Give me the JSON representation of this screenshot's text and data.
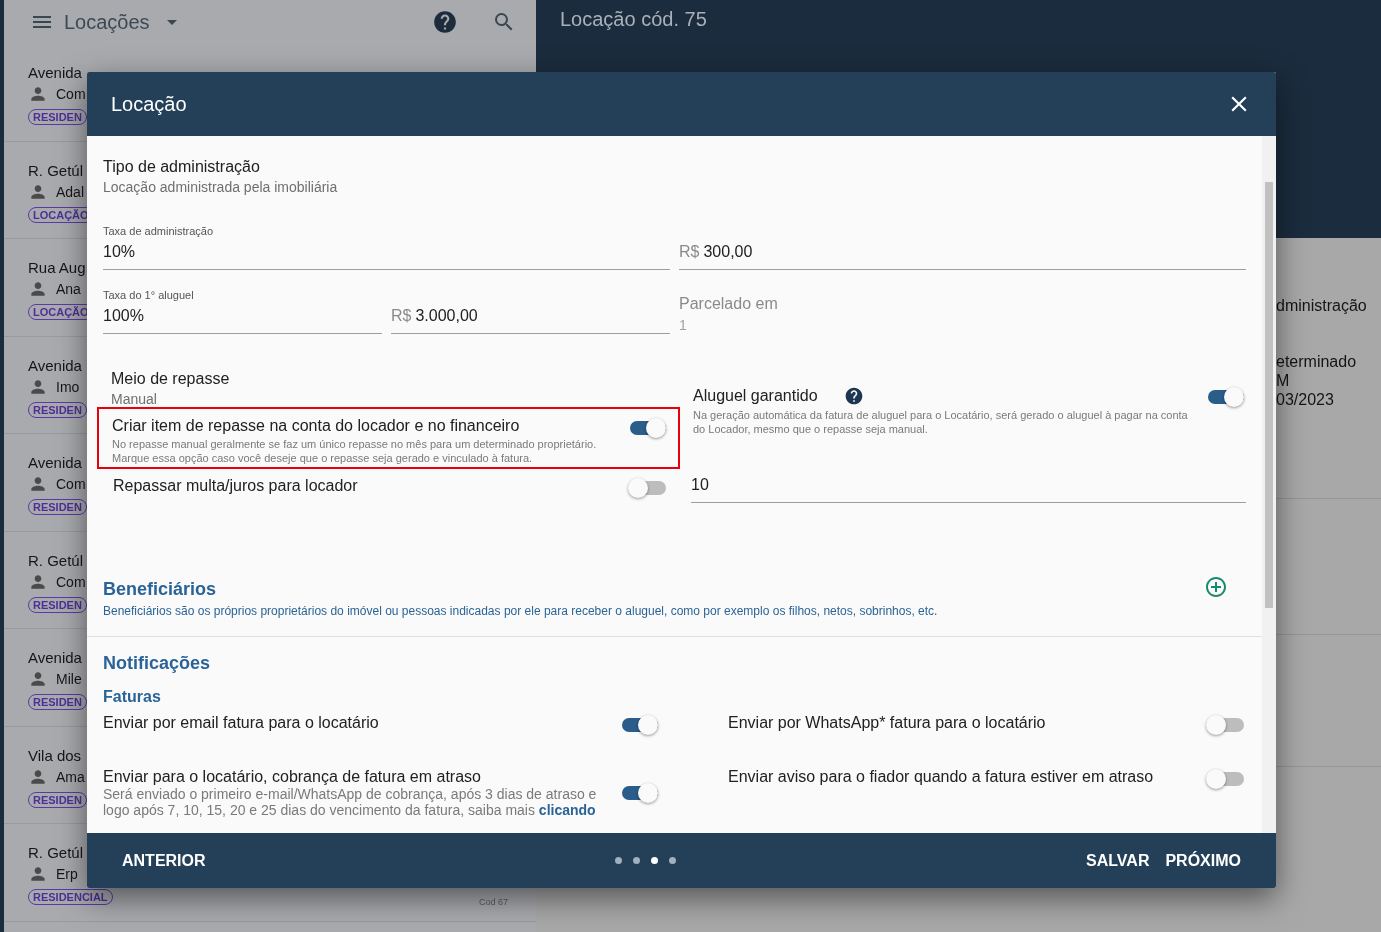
{
  "app_bar": {
    "title": "Locações"
  },
  "rentals": [
    {
      "address": "Avenida",
      "person": "Com",
      "tag": "RESIDEN"
    },
    {
      "address": "R. Getúl",
      "person": "Adal",
      "tag": "LOCAÇÃO"
    },
    {
      "address": "Rua Aug",
      "person": "Ana",
      "tag": "LOCAÇÃO"
    },
    {
      "address": "Avenida",
      "person": "Imo",
      "tag": "RESIDEN"
    },
    {
      "address": "Avenida",
      "person": "Com",
      "tag": "RESIDEN"
    },
    {
      "address": "R. Getúl",
      "person": "Com",
      "tag": "RESIDEN"
    },
    {
      "address": "Avenida",
      "person": "Mile",
      "tag": "RESIDEN"
    },
    {
      "address": "Vila dos",
      "person": "Ama",
      "tag": "RESIDEN"
    },
    {
      "address": "R. Getúl",
      "person": "Erp",
      "tag": "RESIDENCIAL",
      "code": "Cod 67"
    }
  ],
  "detail": {
    "title": "Locação cód. 75",
    "lines": [
      "dministração",
      "eterminado",
      "M",
      "03/2023"
    ]
  },
  "dialog": {
    "title": "Locação",
    "admin_type": {
      "label": "Tipo de administração",
      "value": "Locação administrada pela imobiliária"
    },
    "fields": [
      {
        "kind": "text",
        "label": "Taxa de administração",
        "value": "10%"
      },
      {
        "kind": "money",
        "prefix": "R$",
        "value": "300,00"
      },
      {
        "kind": "text",
        "label": "Taxa do 1° aluguel",
        "value": "100%"
      },
      {
        "kind": "money",
        "prefix": "R$",
        "value": "3.000,00"
      },
      {
        "kind": "disabled",
        "label": "Parcelado em",
        "value": "1"
      }
    ],
    "transfer_method": {
      "label": "Meio de repasse",
      "value": "Manual"
    },
    "transfer_options": [
      {
        "label": "Criar item de repasse na conta do locador e no financeiro",
        "description": "No repasse manual geralmente se faz um único repasse no mês para um determinado proprietário. Marque essa opção caso você deseje que o repasse seja gerado e vinculado à fatura.",
        "on": true,
        "highlighted": true
      },
      {
        "label": "Repassar multa/juros para locador",
        "on": false,
        "highlighted": false
      }
    ],
    "guaranteed_rent": {
      "label": "Aluguel garantido",
      "on": true,
      "description": "Na geração automática da fatura de aluguel para o Locatário, será gerado o aluguel à pagar na conta do Locador, mesmo que o repasse seja manual.",
      "value": "10"
    },
    "beneficiaries": {
      "title": "Beneficiários",
      "description": "Beneficiários são os próprios proprietários do imóvel ou pessoas indicadas por ele para receber o aluguel, como por exemplo os filhos, netos, sobrinhos, etc."
    },
    "notifications": {
      "title": "Notificações",
      "subtitle": "Faturas",
      "options": [
        {
          "label": "Enviar por email fatura para o locatário",
          "on": true
        },
        {
          "label": "Enviar por WhatsApp* fatura para o locatário",
          "on": false
        },
        {
          "label": "Enviar para o locatário, cobrança de fatura em atraso",
          "on": true,
          "description": "Será enviado o primeiro e-mail/WhatsApp de cobrança, após 3 dias de atraso e logo após 7, 10, 15, 20 e 25 dias do vencimento da fatura, saiba mais",
          "link": "clicando"
        },
        {
          "label": "Enviar aviso para o fiador quando a fatura estiver em atraso",
          "on": false
        }
      ]
    },
    "footer": {
      "back": "ANTERIOR",
      "save": "SALVAR",
      "next": "PRÓXIMO",
      "steps": [
        {
          "selected": false
        },
        {
          "selected": false
        },
        {
          "selected": true
        },
        {
          "selected": false
        }
      ]
    }
  }
}
